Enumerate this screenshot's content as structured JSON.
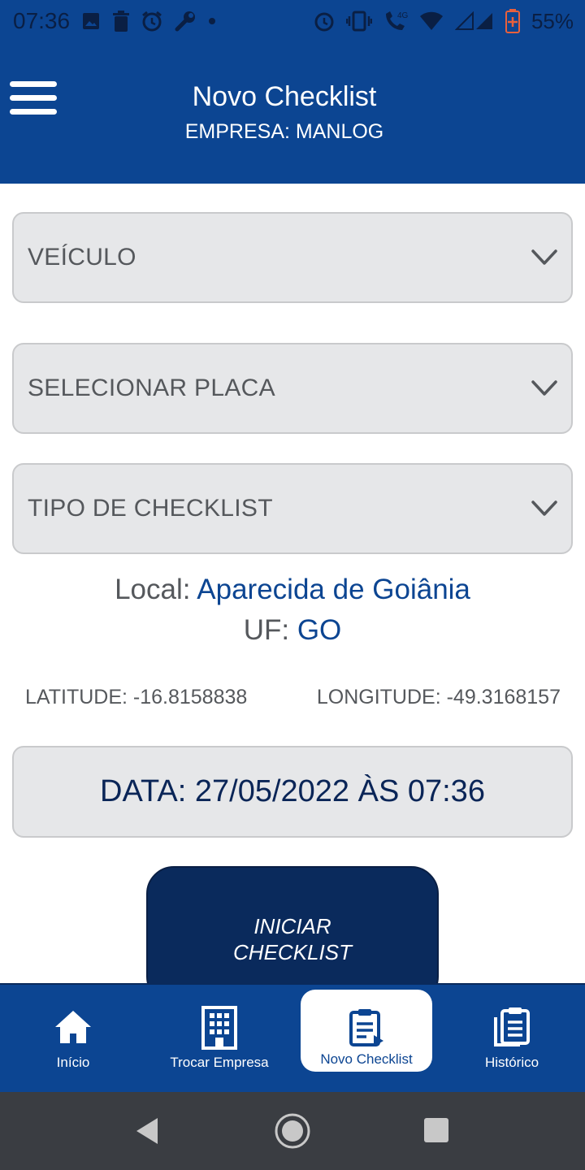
{
  "status_bar": {
    "time": "07:36",
    "battery": "55%",
    "left_icons": [
      "image-icon",
      "trash-icon",
      "alarm-icon",
      "wrench-icon",
      "dot-icon"
    ],
    "right_icons": [
      "alarm-icon",
      "vibrate-icon",
      "call-4g-icon",
      "wifi-icon",
      "signal-icon",
      "battery-icon"
    ]
  },
  "app_bar": {
    "title": "Novo Checklist",
    "subtitle": "EMPRESA: MANLOG",
    "menu_icon": "hamburger-menu-icon"
  },
  "form": {
    "veiculo": "VEÍCULO",
    "placa": "SELECIONAR PLACA",
    "tipo": "TIPO DE CHECKLIST"
  },
  "location": {
    "local_label": "Local:",
    "local_value": "Aparecida de Goiânia",
    "uf_label": "UF:",
    "uf_value": "GO",
    "latitude": "LATITUDE: -16.8158838",
    "longitude": "LONGITUDE: -49.3168157"
  },
  "date": "DATA: 27/05/2022 ÀS 07:36",
  "start_button": {
    "line1": "INICIAR",
    "line2": "CHECKLIST"
  },
  "bottom_nav": {
    "items": [
      {
        "label": "Início",
        "icon": "home-icon"
      },
      {
        "label": "Trocar Empresa",
        "icon": "building-icon"
      },
      {
        "label": "Novo Checklist",
        "icon": "clipboard-arrow-icon",
        "active": true
      },
      {
        "label": "Histórico",
        "icon": "clipboard-history-icon"
      }
    ]
  },
  "colors": {
    "primary": "#0c4592",
    "dark_button": "#0a2a5c",
    "field_bg": "#e6e7e9",
    "system_nav": "#3a3d42"
  }
}
